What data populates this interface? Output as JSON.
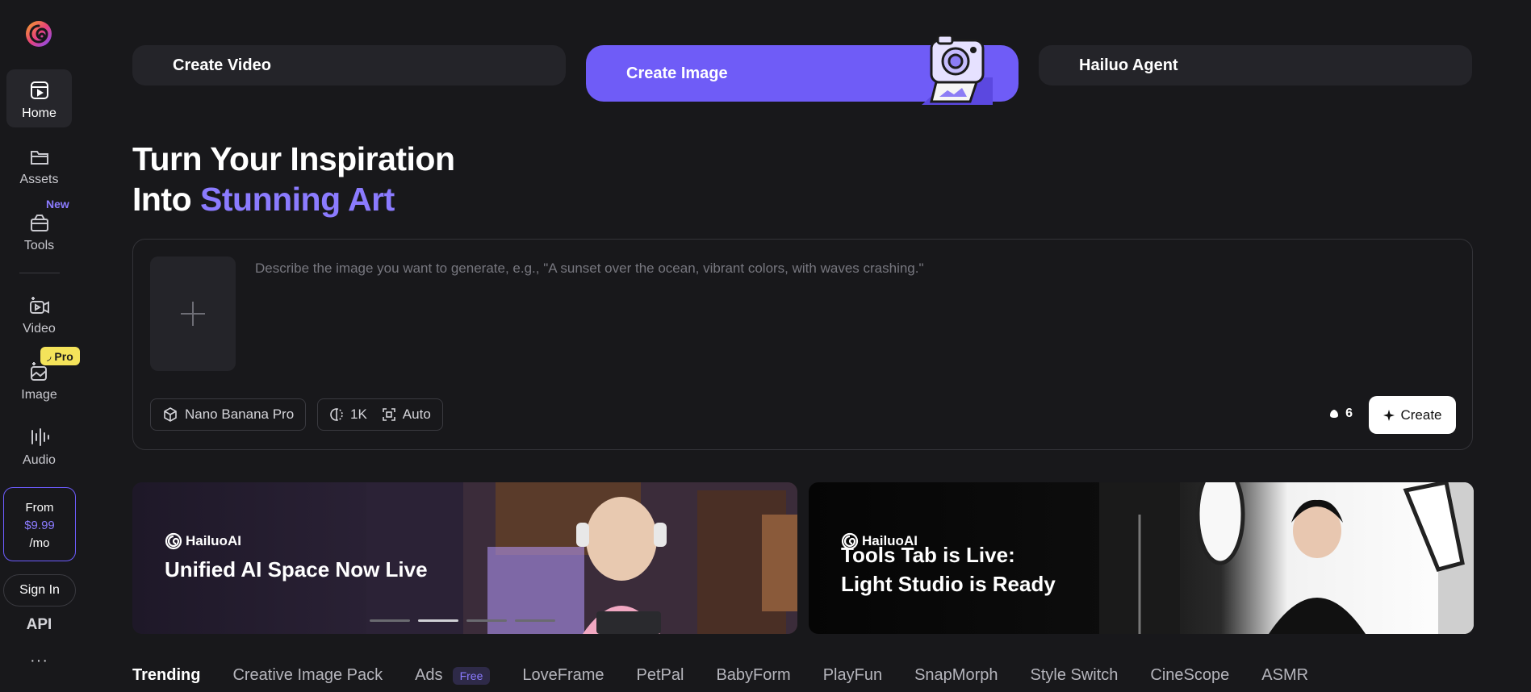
{
  "sidebar": {
    "items": [
      {
        "label": "Home",
        "icon": "home-icon",
        "active": true
      },
      {
        "label": "Assets",
        "icon": "folder-icon"
      },
      {
        "label": "Tools",
        "icon": "tools-icon",
        "badge": "New"
      },
      {
        "label": "Video",
        "icon": "video-icon"
      },
      {
        "label": "Image",
        "icon": "image-icon",
        "badge": "Pro"
      },
      {
        "label": "Audio",
        "icon": "audio-icon"
      }
    ],
    "price": {
      "from": "From",
      "amount": "$9.99",
      "period": "/mo"
    },
    "signin": "Sign In",
    "api": "API",
    "more": "···"
  },
  "tabs": {
    "video": "Create Video",
    "image": "Create Image",
    "agent": "Hailuo Agent"
  },
  "headline": {
    "line1": "Turn Your Inspiration",
    "line2_prefix": "Into ",
    "line2_accent": "Stunning Art"
  },
  "prompt": {
    "placeholder": "Describe the image you want to generate, e.g., \"A sunset over the ocean, vibrant colors, with waves crashing.\"",
    "model": "Nano Banana Pro",
    "resolution": "1K",
    "aspect": "Auto",
    "credits": "6",
    "create": "Create"
  },
  "banners": [
    {
      "brand": "HailuoAI",
      "title": "Unified AI Space Now Live"
    },
    {
      "brand": "HailuoAI",
      "title_line1": "Tools Tab is Live:",
      "title_line2": "Light Studio is Ready"
    }
  ],
  "categories": {
    "trending": "Trending",
    "items": [
      "Creative Image Pack",
      "Ads",
      "LoveFrame",
      "PetPal",
      "BabyForm",
      "PlayFun",
      "SnapMorph",
      "Style Switch",
      "CineScope",
      "ASMR"
    ],
    "free_badge": "Free"
  },
  "colors": {
    "accent": "#6f5cf7",
    "accent_text": "#8b7bff",
    "background": "#18181b",
    "pro_badge": "#f4e35a"
  }
}
